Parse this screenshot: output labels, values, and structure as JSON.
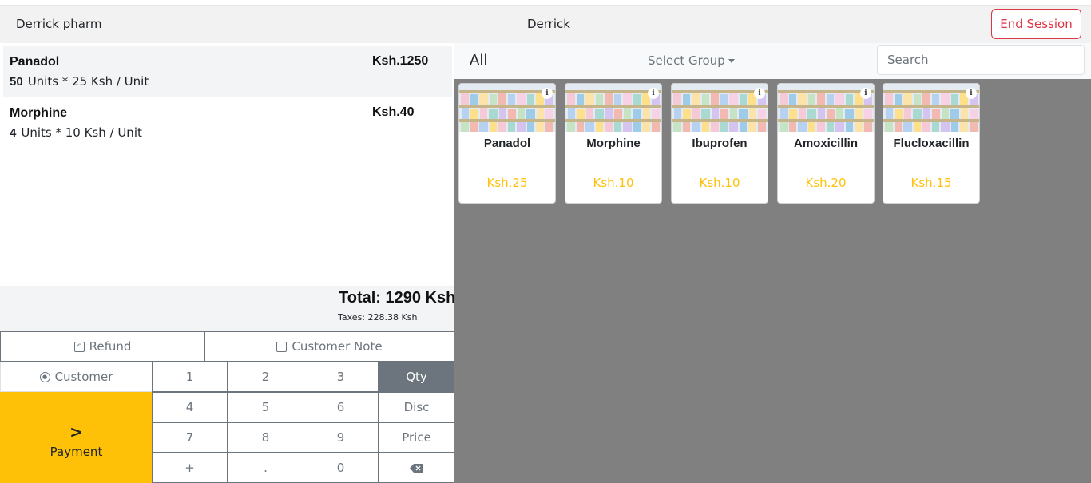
{
  "header": {
    "store_name": "Derrick pharm",
    "user_name": "Derrick",
    "end_session_label": "End Session"
  },
  "order_lines": [
    {
      "name": "Panadol",
      "price": "Ksh.1250",
      "qty": "50",
      "unit_info": "Units * 25 Ksh / Unit",
      "selected": true
    },
    {
      "name": "Morphine",
      "price": "Ksh.40",
      "qty": "4",
      "unit_info": "Units * 10 Ksh / Unit",
      "selected": false
    }
  ],
  "totals": {
    "total_label": "Total: 1290 Ksh",
    "taxes_label": "Taxes:  228.38  Ksh"
  },
  "controls": {
    "refund_label": "Refund",
    "customer_note_label": "Customer Note",
    "customer_label": "Customer",
    "payment_label": "Payment"
  },
  "numpad": {
    "rows": [
      [
        "1",
        "2",
        "3",
        "Qty"
      ],
      [
        "4",
        "5",
        "6",
        "Disc"
      ],
      [
        "7",
        "8",
        "9",
        "Price"
      ],
      [
        "+",
        ".",
        "0",
        "⌫"
      ]
    ],
    "active_mode": "Qty"
  },
  "categories": {
    "all_label": "All",
    "select_group_label": "Select Group"
  },
  "search": {
    "placeholder": "Search",
    "value": ""
  },
  "products": [
    {
      "name": "Panadol",
      "price": "Ksh.25"
    },
    {
      "name": "Morphine",
      "price": "Ksh.10"
    },
    {
      "name": "Ibuprofen",
      "price": "Ksh.10"
    },
    {
      "name": "Amoxicillin",
      "price": "Ksh.20"
    },
    {
      "name": "Flucloxacillin",
      "price": "Ksh.15"
    }
  ],
  "colors": {
    "accent_yellow": "#ffc107",
    "danger": "#dc3545",
    "secondary": "#6c757d",
    "product_area_bg": "#808080"
  },
  "icons": {
    "refund": "refund-icon",
    "note": "note-icon",
    "customer": "user-circle-icon",
    "payment": "chevron-right-icon",
    "product_info": "info-icon",
    "backspace": "backspace-icon"
  }
}
